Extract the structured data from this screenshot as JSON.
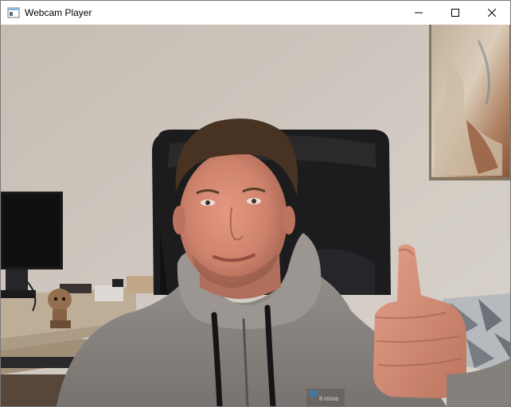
{
  "window": {
    "title": "Webcam Player"
  },
  "icons": {
    "app": "webcam-player-app-icon",
    "minimize": "minimize-icon",
    "maximize": "maximize-icon",
    "close": "close-icon"
  },
  "frame": {
    "hoodie_logo_text": "it-nova"
  },
  "colors": {
    "wall": "#d9d2c8",
    "chair": "#1b1b1d",
    "hoodie": "#8e8a86",
    "skin": "#d98a72",
    "hair": "#4a3422"
  }
}
